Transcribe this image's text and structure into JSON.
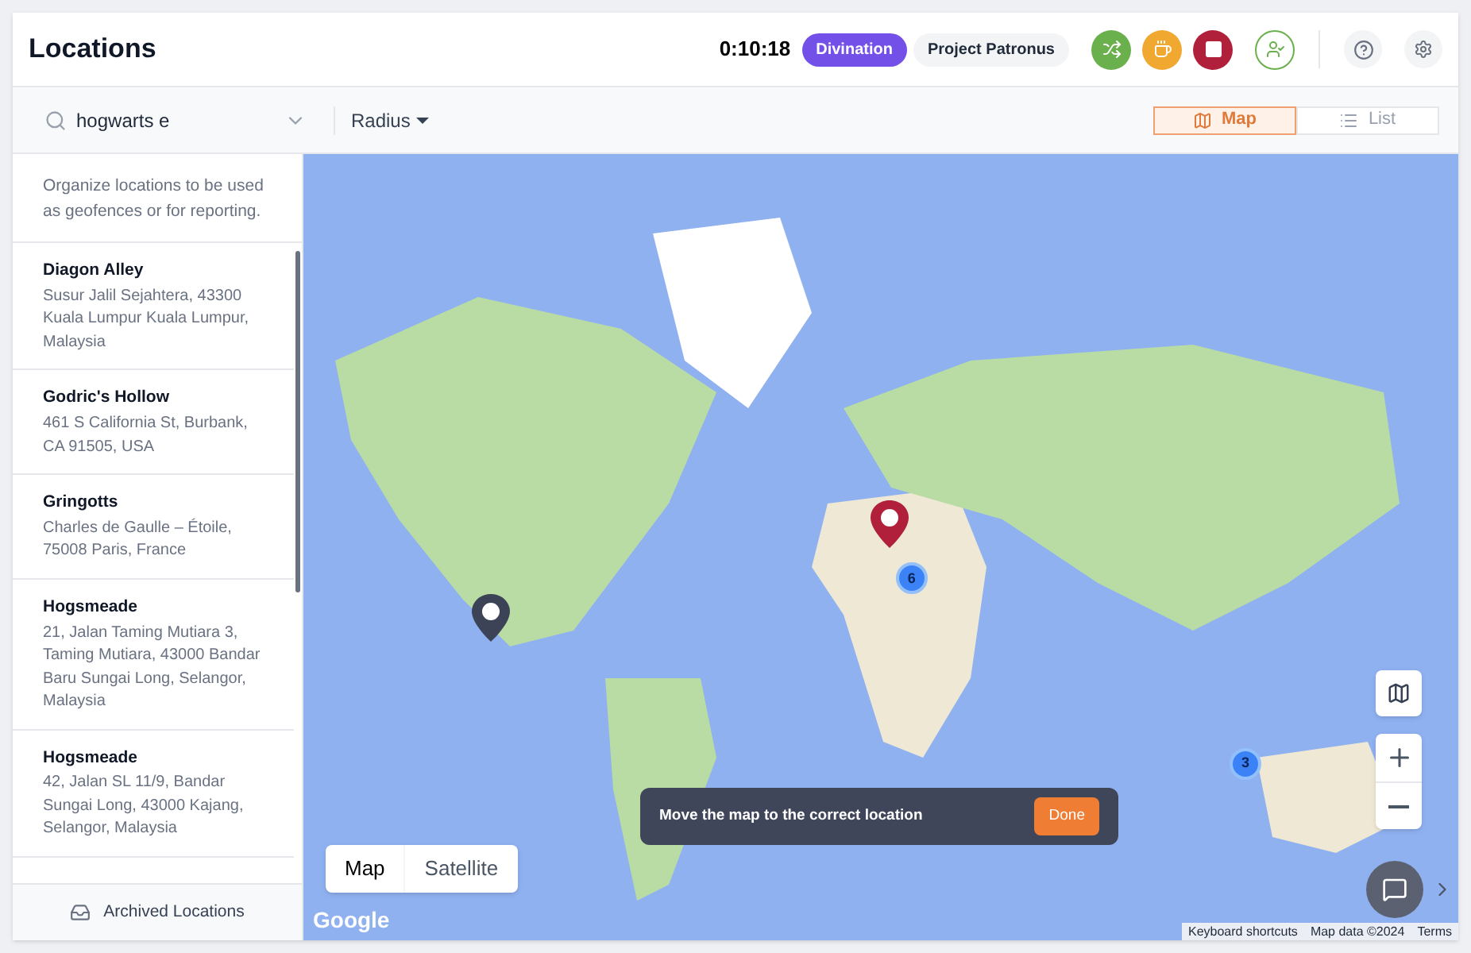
{
  "header": {
    "title": "Locations",
    "timer": "0:10:18",
    "badges": [
      {
        "label": "Divination",
        "selected": true
      },
      {
        "label": "Project Patronus",
        "selected": false
      }
    ],
    "actions": [
      {
        "kind": "switch",
        "color": "#6ab04c"
      },
      {
        "kind": "break",
        "color": "#f0a830"
      },
      {
        "kind": "stop",
        "color": "#b0203a"
      }
    ]
  },
  "toolbar": {
    "search": {
      "value": "hogwarts e"
    },
    "filter": "Radius",
    "views": [
      {
        "label": "Map",
        "selected": true
      },
      {
        "label": "List",
        "selected": false
      }
    ]
  },
  "sidebar": {
    "intro": "Organize locations to be used as geofences or for reporting.",
    "items": [
      {
        "name": "Diagon Alley",
        "address": "Susur Jalil Sejahtera, 43300 Kuala Lumpur Kuala Lumpur, Malaysia"
      },
      {
        "name": "Godric's Hollow",
        "address": "461 S California St, Burbank, CA 91505, USA"
      },
      {
        "name": "Gringotts",
        "address": "Charles de Gaulle – Étoile, 75008 Paris, France"
      },
      {
        "name": "Hogsmeade",
        "address": "21, Jalan Taming Mutiara 3, Taming Mutiara, 43000 Bandar Baru Sungai Long, Selangor, Malaysia"
      },
      {
        "name": "Hogsmeade",
        "address": "42, Jalan SL 11/9, Bandar Sungai Long, 43000 Kajang, Selangor, Malaysia"
      }
    ],
    "footer": "Archived Locations"
  },
  "map": {
    "pins": [
      {
        "color": "#b0203a"
      },
      {
        "color": "#3d4356"
      }
    ],
    "clusters": [
      "6",
      "3"
    ],
    "types": [
      {
        "label": "Map",
        "selected": true
      },
      {
        "label": "Satellite",
        "selected": false
      }
    ],
    "toast": {
      "message": "Move the map to the correct location",
      "button": "Done"
    },
    "logo": "Google",
    "attribution": [
      "Keyboard shortcuts",
      "Map data ©2024",
      "Terms"
    ]
  }
}
